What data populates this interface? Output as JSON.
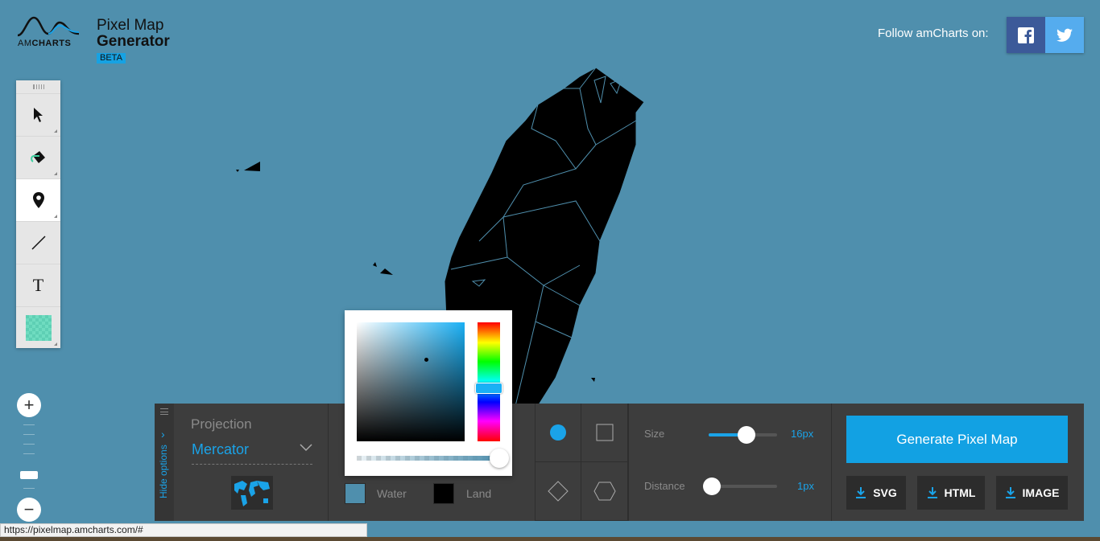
{
  "header": {
    "logo_am": "AM",
    "logo_charts": "CHARTS",
    "title_line1": "Pixel Map",
    "title_line2": "Generator",
    "badge": "BETA",
    "follow_text": "Follow amCharts on:"
  },
  "social": {
    "facebook_icon": "facebook-icon",
    "twitter_icon": "twitter-icon"
  },
  "toolbar": {
    "tools": [
      {
        "name": "select",
        "icon": "cursor-icon",
        "active": false
      },
      {
        "name": "paint",
        "icon": "paint-bucket-icon",
        "active": false
      },
      {
        "name": "pin",
        "icon": "map-pin-icon",
        "active": true
      },
      {
        "name": "line",
        "icon": "line-icon",
        "active": false
      },
      {
        "name": "text",
        "icon": "text-icon",
        "label": "T",
        "active": false
      },
      {
        "name": "pattern",
        "icon": "pattern-swatch-icon",
        "active": false
      }
    ]
  },
  "zoom": {
    "in_label": "+",
    "out_label": "−"
  },
  "panel": {
    "hide_options": "Hide options",
    "projection_label": "Projection",
    "projection_value": "Mercator",
    "water_label": "Water",
    "land_label": "Land",
    "water_color": "#4f8fad",
    "land_color": "#000000",
    "size_label": "Size",
    "size_value": "16px",
    "size_level": 0.55,
    "distance_label": "Distance",
    "distance_value": "1px",
    "distance_level": 0.05,
    "generate_label": "Generate Pixel Map",
    "export": {
      "svg": "SVG",
      "html": "HTML",
      "image": "IMAGE"
    }
  },
  "color_picker": {
    "selected_hue": "#1ab0f5"
  },
  "status_bar": {
    "url": "https://pixelmap.amcharts.com/#"
  },
  "colors": {
    "background": "#4f8fad",
    "accent": "#1aa3e8",
    "panel": "#3d3d3d"
  }
}
